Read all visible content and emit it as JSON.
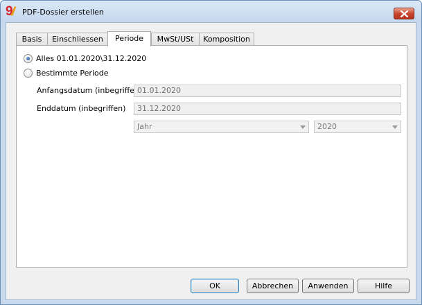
{
  "window": {
    "title": "PDF-Dossier erstellen",
    "app_icon_text": "9"
  },
  "tabs": [
    {
      "label": "Basis",
      "active": false
    },
    {
      "label": "Einschliessen",
      "active": false
    },
    {
      "label": "Periode",
      "active": true
    },
    {
      "label": "MwSt/USt",
      "active": false
    },
    {
      "label": "Komposition",
      "active": false
    }
  ],
  "period": {
    "option_all": {
      "label": "Alles 01.01.2020\\31.12.2020",
      "checked": true
    },
    "option_specific": {
      "label": "Bestimmte Periode",
      "checked": false
    },
    "start_label": "Anfangsdatum (inbegriffen)",
    "start_value": "01.01.2020",
    "end_label": "Enddatum (inbegriffen)",
    "end_value": "31.12.2020",
    "period_type": "Jahr",
    "year": "2020"
  },
  "buttons": {
    "ok": "OK",
    "cancel": "Abbrechen",
    "apply": "Anwenden",
    "help": "Hilfe"
  },
  "colors": {
    "close_button": "#c8472f",
    "app_icon": "#d8262b",
    "disabled_text": "#6d6d6d"
  }
}
